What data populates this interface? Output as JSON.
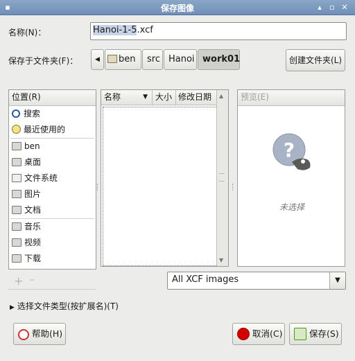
{
  "window": {
    "title": "保存图像"
  },
  "name_row": {
    "label": "名称(N)：",
    "value_selected": "Hanoi-1-5",
    "value_ext": ".xcf"
  },
  "folder_row": {
    "label": "保存于文件夹(F)：",
    "crumbs": [
      "ben",
      "src",
      "Hanoi",
      "work01"
    ],
    "create_folder": "创建文件夹(L)"
  },
  "places": {
    "header": "位置(R)",
    "items": [
      "搜索",
      "最近使用的",
      "ben",
      "桌面",
      "文件系统",
      "图片",
      "文档",
      "音乐",
      "视频",
      "下载"
    ]
  },
  "files": {
    "col_name": "名称",
    "col_size": "大小",
    "col_date": "修改日期"
  },
  "preview": {
    "header": "预览(E)",
    "empty": "未选择"
  },
  "filter": {
    "selected": "All XCF images"
  },
  "file_type_expander": "选择文件类型(按扩展名)(T)",
  "buttons": {
    "help": "帮助(H)",
    "cancel": "取消(C)",
    "save": "保存(S)"
  },
  "colors": {
    "titlebar": "#7a98be",
    "cancel_red": "#d40000",
    "save_green": "#4e9a06"
  }
}
